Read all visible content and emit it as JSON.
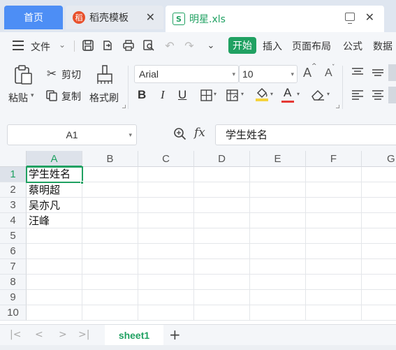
{
  "tabs": {
    "home": "首页",
    "template_logo": "稻",
    "template": "稻壳模板",
    "file_logo": "S",
    "file": "明星.xls",
    "close": "✕"
  },
  "menu": {
    "file": "文件",
    "items": [
      "开始",
      "插入",
      "页面布局",
      "公式",
      "数据"
    ],
    "active": "开始"
  },
  "ribbon": {
    "paste": "粘贴",
    "cut": "剪切",
    "copy": "复制",
    "format_painter": "格式刷",
    "font": "Arial",
    "size": "10",
    "bold": "B",
    "italic": "I",
    "underline": "U",
    "increase_font": "A",
    "decrease_font": "A",
    "font_color": "A",
    "accent_color": "#20a162",
    "fill_color": "#f5d33c",
    "font_color_bar": "#e53935"
  },
  "formula_bar": {
    "cell_ref": "A1",
    "fx": "fx",
    "content": "学生姓名"
  },
  "grid": {
    "columns": [
      "A",
      "B",
      "C",
      "D",
      "E",
      "F",
      "G"
    ],
    "rows": [
      "1",
      "2",
      "3",
      "4",
      "5",
      "6",
      "7",
      "8",
      "9",
      "10"
    ],
    "cells_a": [
      "学生姓名",
      "蔡明超",
      "吴亦凡",
      "汪峰"
    ],
    "selected_cell": "A1"
  },
  "sheets": {
    "tabs": [
      "sheet1"
    ],
    "add": "+"
  }
}
